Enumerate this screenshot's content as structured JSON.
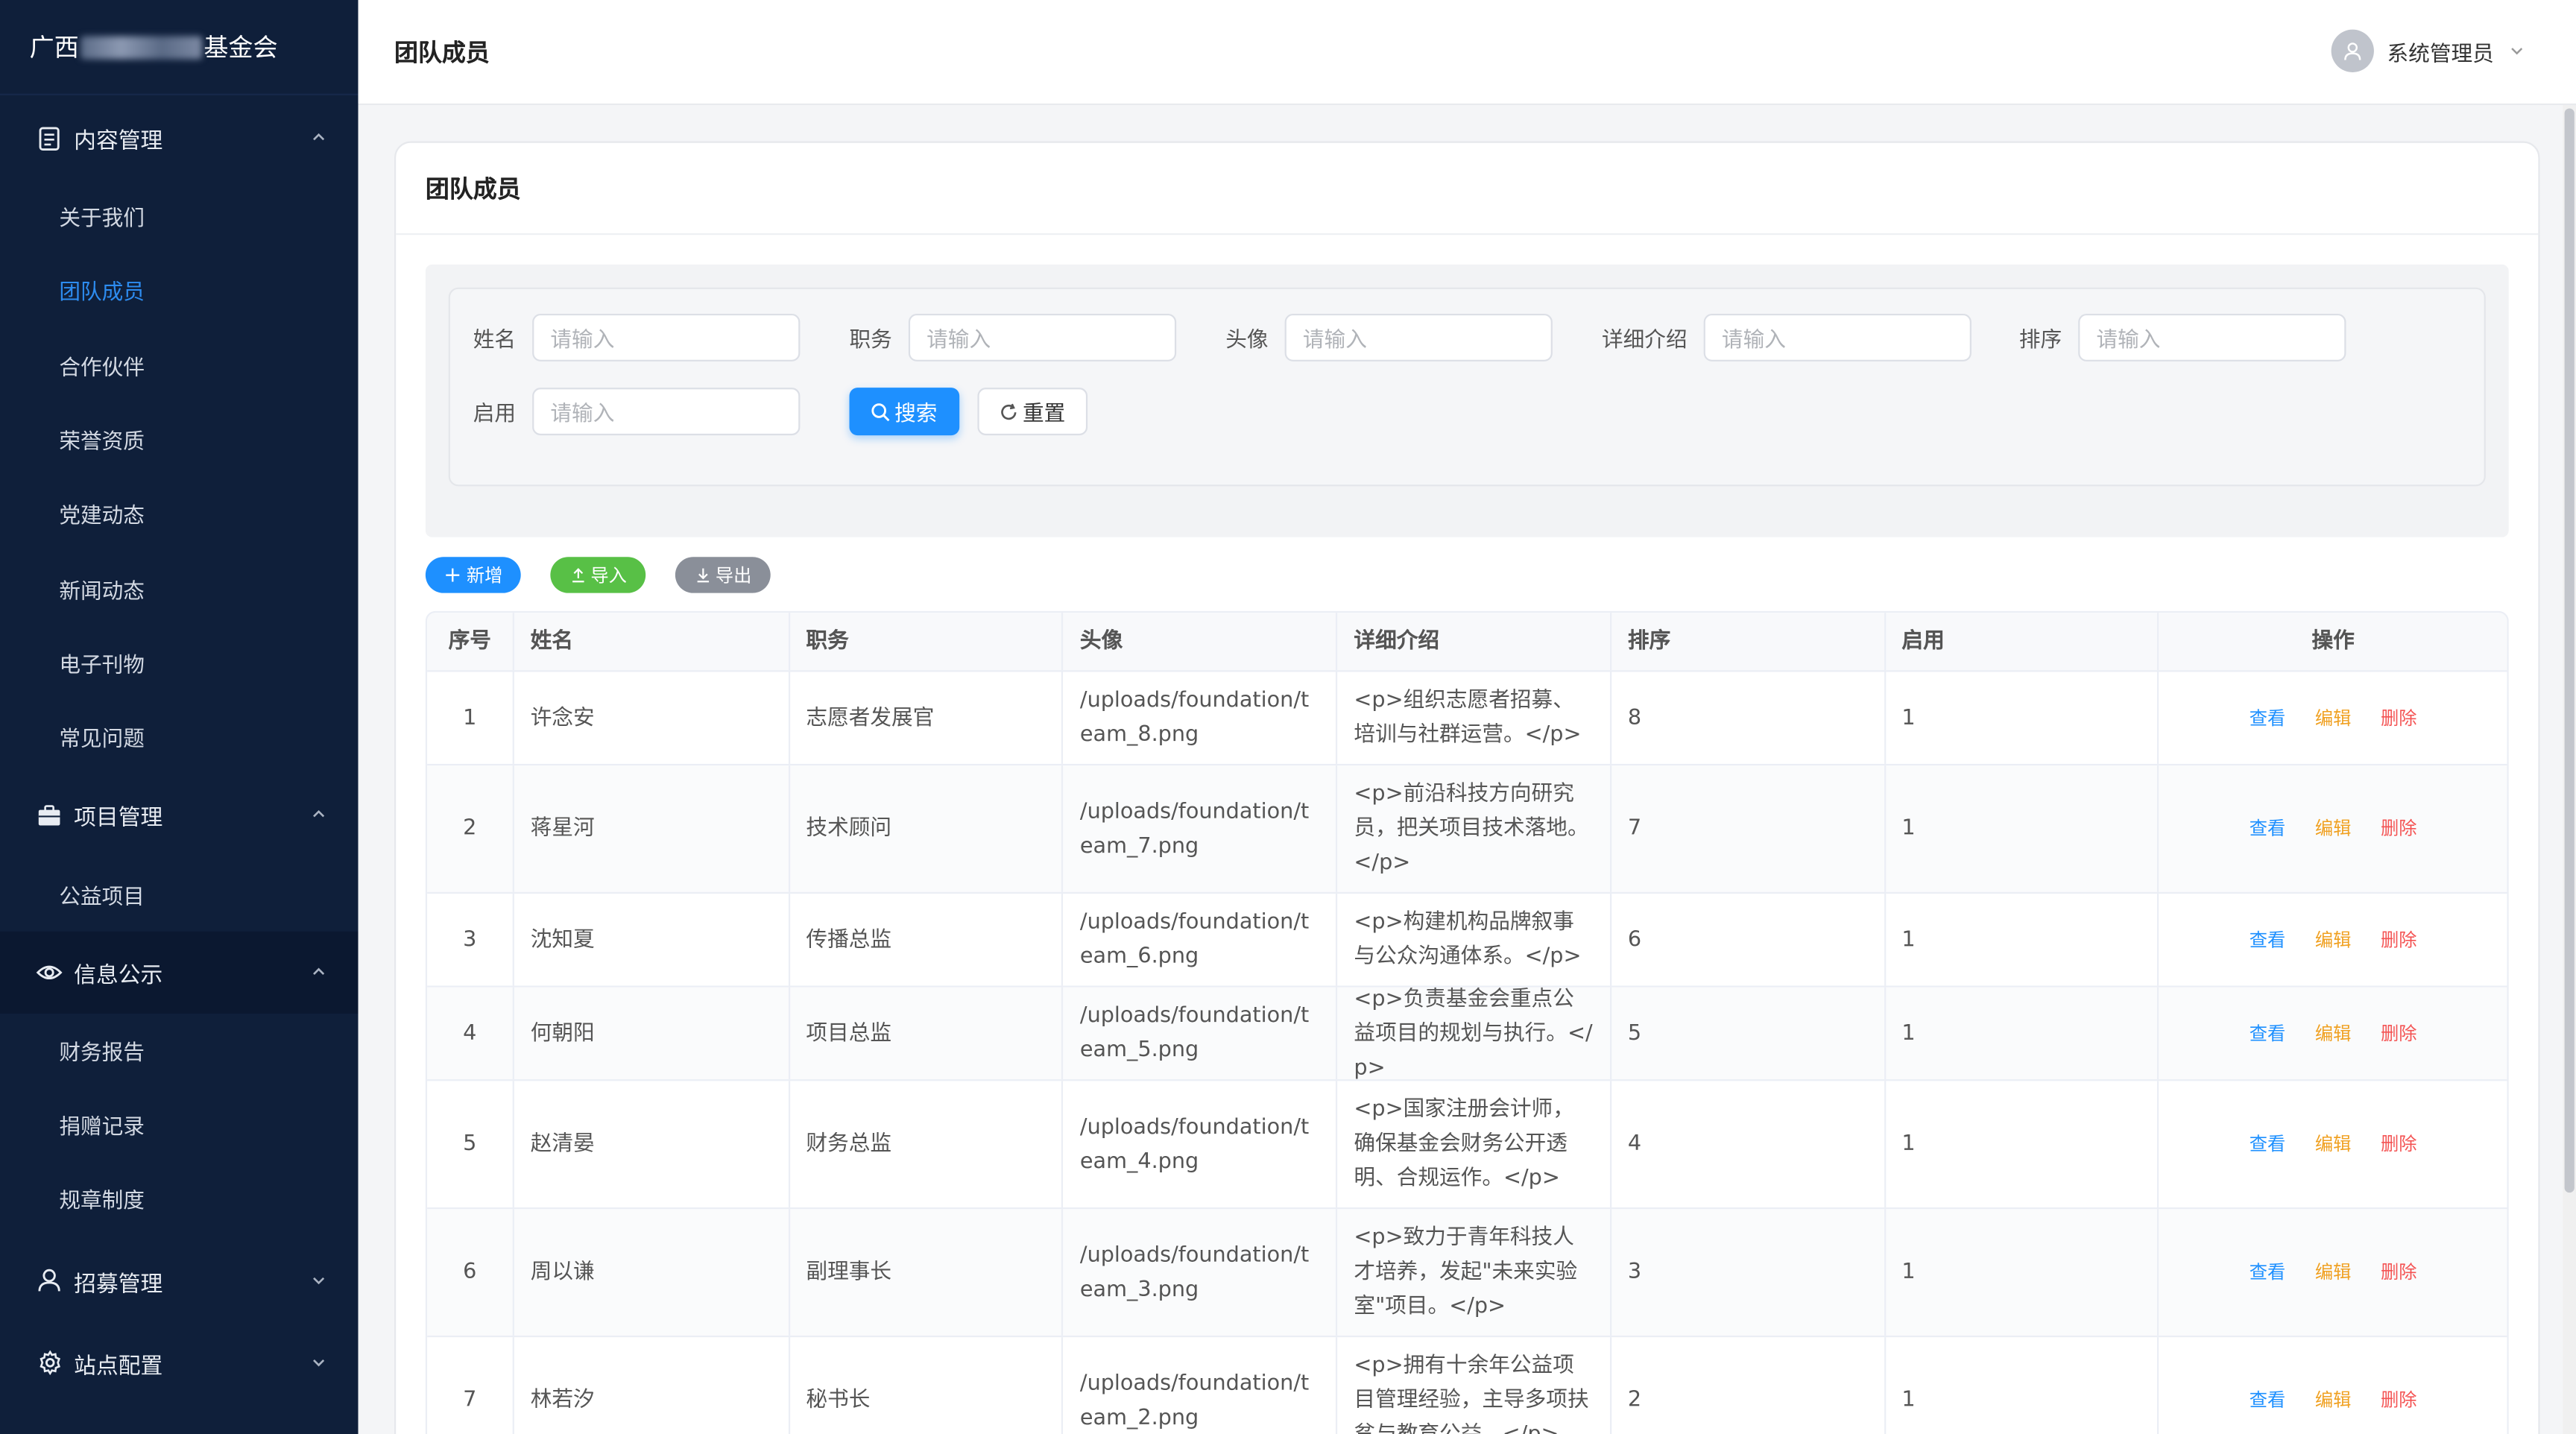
{
  "brand": {
    "prefix": "广西",
    "suffix": "基金会"
  },
  "sidebar": {
    "groups": [
      {
        "label": "内容管理",
        "icon": "document-icon",
        "expanded": true,
        "items": [
          "关于我们",
          "团队成员",
          "合作伙伴",
          "荣誉资质",
          "党建动态",
          "新闻动态",
          "电子刊物",
          "常见问题"
        ]
      },
      {
        "label": "项目管理",
        "icon": "briefcase-icon",
        "expanded": true,
        "items": [
          "公益项目"
        ]
      },
      {
        "label": "信息公示",
        "icon": "eye-icon",
        "expanded": true,
        "items": [
          "财务报告",
          "捐赠记录",
          "规章制度"
        ]
      },
      {
        "label": "招募管理",
        "icon": "user-icon",
        "expanded": false,
        "items": []
      },
      {
        "label": "站点配置",
        "icon": "gear-icon",
        "expanded": false,
        "items": []
      }
    ],
    "active_item": "团队成员"
  },
  "header": {
    "title": "团队成员",
    "user": "系统管理员"
  },
  "card": {
    "title": "团队成员"
  },
  "search": {
    "fields": [
      {
        "label": "姓名",
        "placeholder": "请输入"
      },
      {
        "label": "职务",
        "placeholder": "请输入"
      },
      {
        "label": "头像",
        "placeholder": "请输入"
      },
      {
        "label": "详细介绍",
        "placeholder": "请输入"
      },
      {
        "label": "排序",
        "placeholder": "请输入"
      },
      {
        "label": "启用",
        "placeholder": "请输入"
      }
    ],
    "search_label": "搜索",
    "reset_label": "重置"
  },
  "toolbar": {
    "add_label": "新增",
    "import_label": "导入",
    "export_label": "导出"
  },
  "table": {
    "headers": [
      "序号",
      "姓名",
      "职务",
      "头像",
      "详细介绍",
      "排序",
      "启用",
      "操作"
    ],
    "actions": {
      "view": "查看",
      "edit": "编辑",
      "delete": "删除"
    },
    "rows": [
      {
        "idx": "1",
        "name": "许念安",
        "position": "志愿者发展官",
        "avatar": "/uploads/foundation/team_8.png",
        "detail": "<p>组织志愿者招募、培训与社群运营。</p>",
        "order": "8",
        "enabled": "1"
      },
      {
        "idx": "2",
        "name": "蒋星河",
        "position": "技术顾问",
        "avatar": "/uploads/foundation/team_7.png",
        "detail": "<p>前沿科技方向研究员，把关项目技术落地。</p>",
        "order": "7",
        "enabled": "1"
      },
      {
        "idx": "3",
        "name": "沈知夏",
        "position": "传播总监",
        "avatar": "/uploads/foundation/team_6.png",
        "detail": "<p>构建机构品牌叙事与公众沟通体系。</p>",
        "order": "6",
        "enabled": "1"
      },
      {
        "idx": "4",
        "name": "何朝阳",
        "position": "项目总监",
        "avatar": "/uploads/foundation/team_5.png",
        "detail": "<p>负责基金会重点公益项目的规划与执行。</p>",
        "order": "5",
        "enabled": "1"
      },
      {
        "idx": "5",
        "name": "赵清晏",
        "position": "财务总监",
        "avatar": "/uploads/foundation/team_4.png",
        "detail": "<p>国家注册会计师，确保基金会财务公开透明、合规运作。</p>",
        "order": "4",
        "enabled": "1"
      },
      {
        "idx": "6",
        "name": "周以谦",
        "position": "副理事长",
        "avatar": "/uploads/foundation/team_3.png",
        "detail": "<p>致力于青年科技人才培养，发起\"未来实验室\"项目。</p>",
        "order": "3",
        "enabled": "1"
      },
      {
        "idx": "7",
        "name": "林若汐",
        "position": "秘书长",
        "avatar": "/uploads/foundation/team_2.png",
        "detail": "<p>拥有十余年公益项目管理经验，主导多项扶贫与教育公益...</p>",
        "order": "2",
        "enabled": "1"
      }
    ]
  },
  "colors": {
    "sidebar_bg": "#0f1f3a",
    "accent": "#1e90ff",
    "edit": "#f0a020",
    "delete": "#f45454",
    "import": "#58c046",
    "export": "#8a8f99"
  }
}
